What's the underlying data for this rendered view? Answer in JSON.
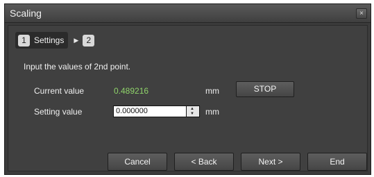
{
  "window": {
    "title": "Scaling",
    "close_glyph": "×"
  },
  "steps": [
    {
      "number": "1",
      "label": "Settings"
    },
    {
      "number": "2",
      "label": ""
    }
  ],
  "instruction": "Input the values of 2nd point.",
  "current": {
    "label": "Current value",
    "value": "0.489216",
    "unit": "mm",
    "value_color": "#8fd36a"
  },
  "setting": {
    "label": "Setting value",
    "value": "0.000000",
    "unit": "mm"
  },
  "buttons": {
    "stop": "STOP",
    "cancel": "Cancel",
    "back": "< Back",
    "next": "Next >",
    "end": "End"
  }
}
